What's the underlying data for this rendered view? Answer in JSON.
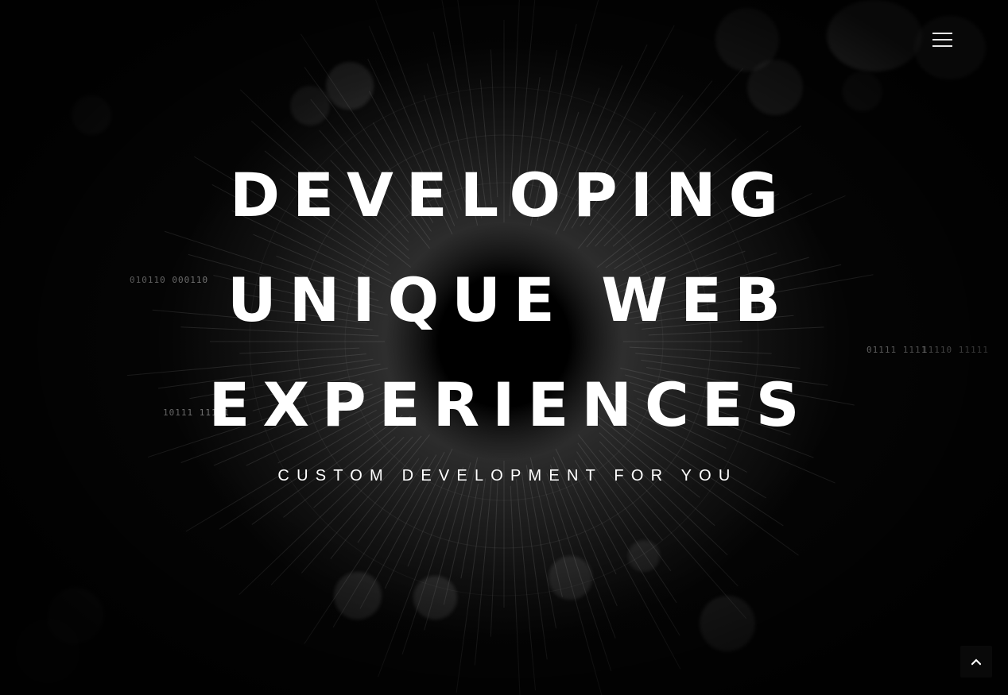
{
  "hero": {
    "headline_lines": [
      "DEVELOPING",
      "UNIQUE WEB",
      "EXPERIENCES"
    ],
    "subtitle": "CUSTOM DEVELOPMENT FOR YOU"
  },
  "decor": {
    "code_snippets": [
      "010110 000110",
      "10111 11101",
      "11110 11111",
      "01111 1111"
    ]
  },
  "icons": {
    "menu": "hamburger-menu-icon",
    "back_to_top": "chevron-up-icon"
  },
  "colors": {
    "text": "#ffffff",
    "background": "#000000"
  }
}
